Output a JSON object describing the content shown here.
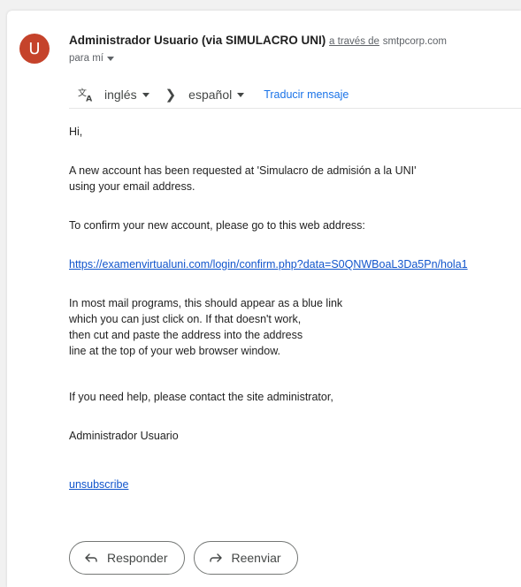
{
  "sender": {
    "avatar_letter": "U",
    "avatar_color": "#c5432b",
    "name": "Administrador Usuario (via SIMULACRO UNI)",
    "via_label": "a través de",
    "via_domain": "smtpcorp.com",
    "recipient_label": "para mí"
  },
  "translate": {
    "icon": "translate-icon",
    "source_lang": "inglés",
    "target_lang": "español",
    "action": "Traducir mensaje",
    "accent_color": "#1a73e8"
  },
  "message": {
    "greeting": "Hi,",
    "new_account_line1": "A new account has been requested at 'Simulacro de admisión a la UNI'",
    "new_account_line2": "using your email address.",
    "confirm": "To confirm your new account, please go to this web address:",
    "confirm_link": "https://examenvirtualuni.com/login/confirm.php?data=S0QNWBoaL3Da5Pn/hola1",
    "mail_programs_lines": [
      "In most mail programs, this should appear as a blue link",
      "which you can just click on. If that doesn't work,",
      "then cut and paste the address into the address",
      "line at the top of your web browser window."
    ],
    "help": "If you need help, please contact the site administrator,",
    "signature": "Administrador Usuario",
    "unsubscribe": "unsubscribe",
    "link_color": "#1155cc"
  },
  "actions": {
    "reply_label": "Responder",
    "reply_icon": "reply-icon",
    "forward_label": "Reenviar",
    "forward_icon": "forward-icon"
  }
}
